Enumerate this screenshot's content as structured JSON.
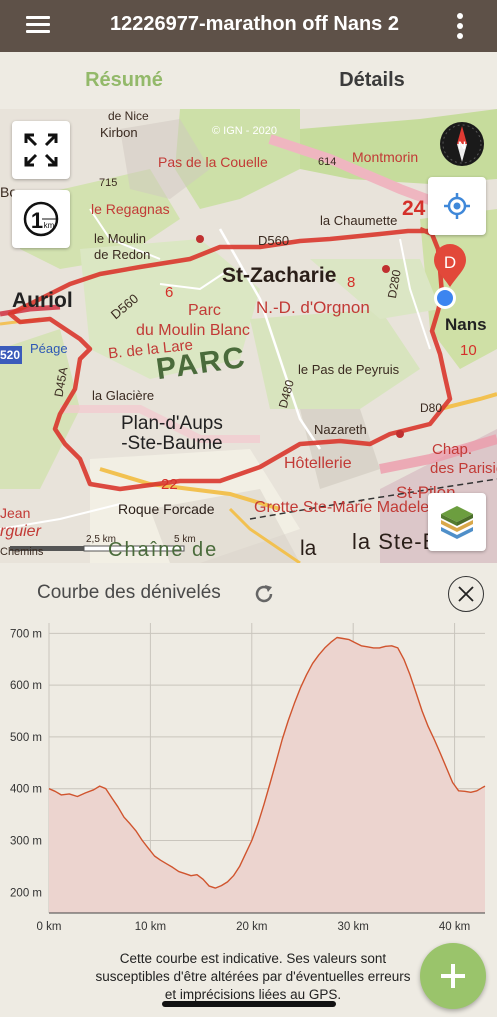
{
  "appbar": {
    "title": "12226977-marathon off Nans 2",
    "menu_icon": "hamburger-menu-icon",
    "more_icon": "more-vertical-icon"
  },
  "tabs": [
    {
      "label": "Résumé",
      "active": true
    },
    {
      "label": "Détails",
      "active": false
    }
  ],
  "map": {
    "copyright": "© IGN - 2020",
    "start_marker": "D",
    "labels": {
      "de_nice": "de Nice",
      "kirbon": "Kirbon",
      "pas_couelle": "Pas de la Couelle",
      "montmorin": "Montmorin",
      "n614": "614",
      "n715": "715",
      "regagnas": "le Regagnas",
      "la_chaumette": "la Chaumette",
      "n24": "24",
      "moulin_redon": "le Moulin\nde Redon",
      "d560a": "D560",
      "d560b": "D560",
      "st_zacharie": "St-Zacharie",
      "d280": "D280",
      "n8": "8",
      "n6": "6",
      "parc": "Parc",
      "nd_orgnon": "N.-D. d'Orgnon",
      "moulin_blanc": "du Moulin Blanc",
      "nans": "Nans",
      "auriol": "Auriol",
      "peage": "Péage",
      "n520": "520",
      "b_lare": "B. de la Lare",
      "parc_big": "PARC",
      "pas_peyruis": "le Pas de Peyruis",
      "n10": "10",
      "la_glaciere": "la Glacière",
      "d480": "D480",
      "d45a": "D45A",
      "d80": "D80",
      "plan_aups": "Plan-d'Aups\n-Ste-Baume",
      "nazareth": "Nazareth",
      "hotellerie": "Hôtellerie",
      "chap": "Chap.",
      "parisiens": "des Parisien",
      "n22": "22",
      "st_pilon": "St-Pilon",
      "roque_forcade": "Roque Forcade",
      "grotte": "Grotte Ste-Marie Madeleine",
      "jean": "Jean",
      "argulier": "rguier",
      "la_ste_b": "la  Ste-Ba",
      "chemins": "Chemins",
      "chaine": "Chaîne de",
      "bo": "Bo",
      "la": "la"
    },
    "scale": {
      "left": "2,5 km",
      "right": "5 km"
    },
    "controls": {
      "fullscreen": "fullscreen-icon",
      "scale_toggle": "one-km-scale-icon",
      "compass": "compass-icon",
      "compass_letter": "N",
      "locate": "locate-icon",
      "layers": "layers-icon",
      "scale_one": "1",
      "scale_km": "km"
    }
  },
  "elevation": {
    "title": "Courbe des dénivelés",
    "refresh_icon": "refresh-icon",
    "close_icon": "close-icon",
    "note": [
      "Cette courbe est indicative. Ses valeurs sont",
      "susceptibles d'être altérées par d'éventuelles erreurs",
      "et imprécisions liées au GPS."
    ],
    "fab_icon": "add-icon"
  },
  "chart_data": {
    "type": "area",
    "title": "Courbe des dénivelés",
    "xlabel": "",
    "ylabel": "",
    "xlim": [
      0,
      43
    ],
    "ylim": [
      160,
      720
    ],
    "x_ticks": [
      0,
      10,
      20,
      30,
      40
    ],
    "x_tick_labels": [
      "0 km",
      "10 km",
      "20 km",
      "30 km",
      "40 km"
    ],
    "y_ticks": [
      200,
      300,
      400,
      500,
      600,
      700
    ],
    "y_tick_labels": [
      "200 m",
      "300 m",
      "400 m",
      "500 m",
      "600 m",
      "700 m"
    ],
    "grid": true,
    "color": "#d0542e",
    "fill": "#ecd4cf",
    "series": [
      {
        "x": [
          0,
          0.6,
          1.2,
          2,
          2.8,
          3.6,
          4.4,
          5.0,
          5.6,
          6.2,
          6.8,
          7.4,
          8.0,
          8.6,
          9.2,
          9.8,
          10.4,
          11.0,
          11.6,
          12.2,
          12.8,
          13.4,
          14.0,
          14.6,
          15.2,
          15.8,
          16.4,
          17.0,
          17.6,
          18.2,
          18.8,
          19.4,
          20.0,
          20.6,
          21.2,
          21.8,
          22.4,
          23.0,
          23.6,
          24.2,
          24.8,
          25.4,
          26.0,
          26.6,
          27.2,
          27.8,
          28.4,
          29.0,
          29.6,
          30.2,
          30.8,
          31.4,
          32.0,
          32.6,
          33.2,
          33.8,
          34.4,
          35.0,
          35.6,
          36.2,
          36.8,
          37.4,
          38.0,
          38.6,
          39.2,
          39.8,
          40.4,
          41.0,
          41.6,
          42.2,
          42.8,
          43.0
        ],
        "y": [
          400,
          395,
          388,
          390,
          385,
          392,
          398,
          405,
          400,
          382,
          365,
          345,
          332,
          318,
          300,
          285,
          270,
          262,
          255,
          248,
          240,
          236,
          232,
          234,
          225,
          212,
          208,
          213,
          220,
          232,
          250,
          275,
          300,
          332,
          370,
          410,
          452,
          495,
          532,
          565,
          595,
          620,
          642,
          658,
          672,
          683,
          692,
          690,
          688,
          682,
          676,
          674,
          672,
          672,
          675,
          676,
          672,
          650,
          620,
          585,
          550,
          520,
          495,
          468,
          440,
          412,
          396,
          395,
          393,
          396,
          403,
          405
        ]
      }
    ]
  }
}
